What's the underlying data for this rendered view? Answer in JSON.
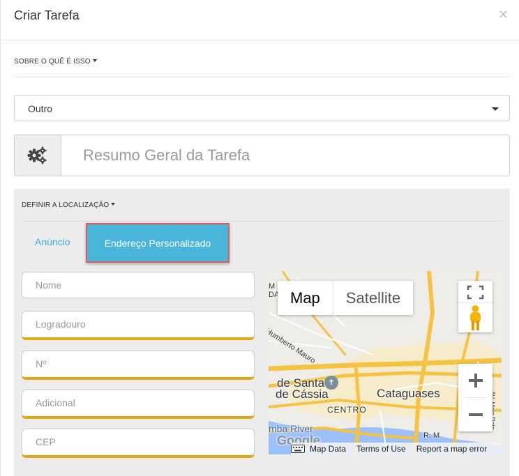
{
  "modal": {
    "title": "Criar Tarefa",
    "close": "×"
  },
  "about": {
    "label": "SOBRE O QUÊ É ISSO"
  },
  "category": {
    "value": "Outro"
  },
  "summary": {
    "placeholder": "Resumo Geral da Tarefa",
    "icon": "gears-icon"
  },
  "location": {
    "label": "DEFINIR A LOCALIZAÇÃO",
    "tabs": {
      "ad": "Anúncio",
      "custom": "Endereço Personalizado"
    },
    "fields": {
      "name": "Nome",
      "street": "Logradouro",
      "number": "Nº",
      "extra": "Adicional",
      "zip": "CEP"
    },
    "map": {
      "type_map": "Map",
      "type_satellite": "Satellite",
      "labels": {
        "street1": "Humberto Mauro",
        "poi": "de Santa",
        "poi2": "de Cássia",
        "city": "Cataguases",
        "district": "CENTRO",
        "river": "mba River",
        "av": "AV. Meia Pata",
        "corner1": "M",
        "corner2": "DA",
        "corner3": "R. M"
      },
      "footer": {
        "data": "Map Data",
        "terms": "Terms of Use",
        "report": "Report a map error"
      },
      "google": "Google"
    }
  }
}
